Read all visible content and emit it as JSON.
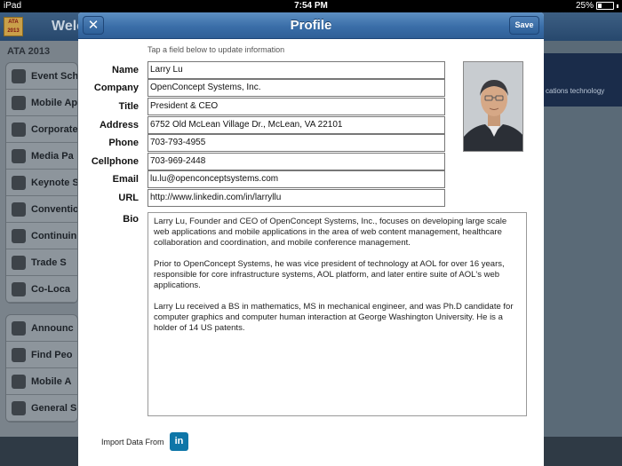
{
  "status_bar": {
    "carrier": "iPad",
    "time": "7:54 PM",
    "battery": "25%",
    "battery_level": 0.25
  },
  "background_app": {
    "title": "Welc",
    "logo_text": "ATA 2013",
    "section": "ATA 2013",
    "menu_group_1": [
      "Event Sch",
      "Mobile Ap",
      "Corporate",
      "Media Pa",
      "Keynote Sp",
      "Conventio",
      "Continuin",
      "Trade S",
      "Co-Loca"
    ],
    "menu_group_2": [
      "Announc",
      "Find Peo",
      "Mobile A",
      "General S"
    ],
    "banner_text": "cations technology"
  },
  "modal": {
    "title": "Profile",
    "close_icon": "close-x-icon",
    "save_label": "Save",
    "hint": "Tap a field below to update information",
    "fields": [
      {
        "label": "Name",
        "value": "Larry Lu"
      },
      {
        "label": "Company",
        "value": "OpenConcept Systems, Inc."
      },
      {
        "label": "Title",
        "value": "President & CEO"
      },
      {
        "label": "Address",
        "value": "6752 Old McLean Village Dr., McLean, VA 22101"
      },
      {
        "label": "Phone",
        "value": "703-793-4955"
      },
      {
        "label": "Cellphone",
        "value": "703-969-2448"
      },
      {
        "label": "Email",
        "value": "lu.lu@openconceptsystems.com"
      },
      {
        "label": "URL",
        "value": "http://www.linkedin.com/in/larryllu"
      }
    ],
    "bio_label": "Bio",
    "bio_paragraphs": [
      "Larry Lu, Founder and CEO of OpenConcept Systems, Inc., focuses on developing large scale web applications and mobile applications in the area of web content management, healthcare collaboration and coordination, and mobile conference management.",
      "Prior to OpenConcept Systems, he was vice president of technology at AOL for over 16 years, responsible for core infrastructure systems, AOL platform, and later entire suite of AOL's web applications.",
      "Larry Lu received a BS in mathematics, MS in mechanical engineer, and was Ph.D candidate for computer graphics and computer human interaction at George Washington University. He is a holder of 14 US patents."
    ],
    "import_label": "Import Data From",
    "linkedin_text": "in"
  },
  "colors": {
    "nav_blue": "#3a6ea8",
    "linkedin_blue": "#0e76a8"
  }
}
